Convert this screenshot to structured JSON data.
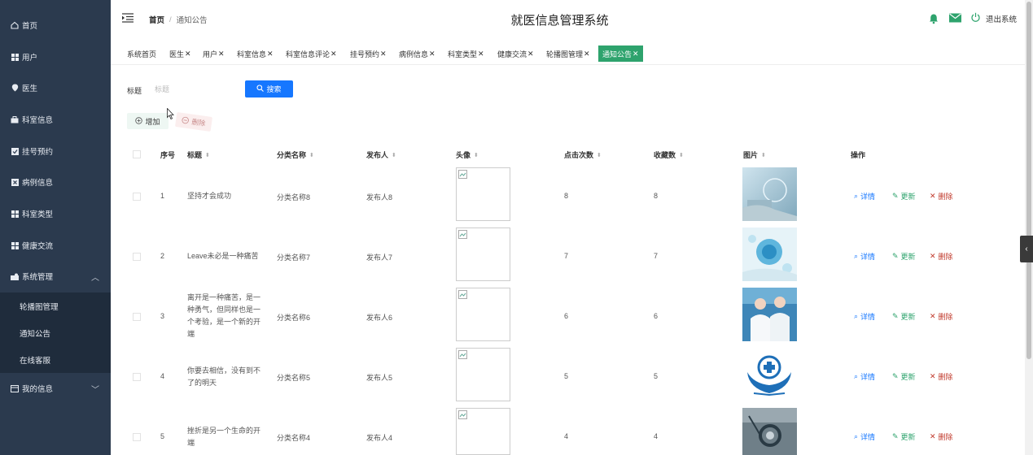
{
  "sidebar": {
    "items": [
      {
        "label": "首页",
        "icon": "home-icon"
      },
      {
        "label": "用户",
        "icon": "grid-icon"
      },
      {
        "label": "医生",
        "icon": "pin-icon"
      },
      {
        "label": "科室信息",
        "icon": "briefcase-icon"
      },
      {
        "label": "挂号预约",
        "icon": "check-square-icon"
      },
      {
        "label": "病例信息",
        "icon": "square-x-icon"
      },
      {
        "label": "科室类型",
        "icon": "grid-icon"
      },
      {
        "label": "健康交流",
        "icon": "grid-icon"
      },
      {
        "label": "系统管理",
        "icon": "settings-icon"
      },
      {
        "label": "我的信息",
        "icon": "card-icon"
      }
    ],
    "submenu": [
      "轮播图管理",
      "通知公告",
      "在线客服"
    ]
  },
  "header": {
    "breadcrumb_home": "首页",
    "breadcrumb_sep": "/",
    "breadcrumb_current": "通知公告",
    "title": "就医信息管理系统",
    "logout": "退出系统"
  },
  "tabs": [
    {
      "label": "系统首页",
      "closable": false
    },
    {
      "label": "医生",
      "closable": true
    },
    {
      "label": "用户",
      "closable": true
    },
    {
      "label": "科室信息",
      "closable": true
    },
    {
      "label": "科室信息评论",
      "closable": true
    },
    {
      "label": "挂号预约",
      "closable": true
    },
    {
      "label": "病例信息",
      "closable": true
    },
    {
      "label": "科室类型",
      "closable": true
    },
    {
      "label": "健康交流",
      "closable": true
    },
    {
      "label": "轮播图管理",
      "closable": true
    },
    {
      "label": "通知公告",
      "closable": true,
      "active": true
    }
  ],
  "search": {
    "label": "标题",
    "placeholder": "标题",
    "button": "搜索"
  },
  "actions": {
    "add": "增加",
    "delete": "删除"
  },
  "table": {
    "headers": {
      "index": "序号",
      "title": "标题",
      "category": "分类名称",
      "publisher": "发布人",
      "avatar": "头像",
      "clicks": "点击次数",
      "favorites": "收藏数",
      "picture": "图片",
      "operation": "操作"
    },
    "row_actions": {
      "detail": "详情",
      "update": "更新",
      "remove": "删除"
    },
    "rows": [
      {
        "index": "1",
        "title": "坚持才会成功",
        "category": "分类名称8",
        "publisher": "发布人8",
        "clicks": "8",
        "favorites": "8"
      },
      {
        "index": "2",
        "title": "Leave未必是一种痛苦",
        "category": "分类名称7",
        "publisher": "发布人7",
        "clicks": "7",
        "favorites": "7"
      },
      {
        "index": "3",
        "title": "离开是一种痛苦，是一种勇气，但同样也是一个考验，是一个新的开端",
        "category": "分类名称6",
        "publisher": "发布人6",
        "clicks": "6",
        "favorites": "6"
      },
      {
        "index": "4",
        "title": "你要去相信，没有到不了的明天",
        "category": "分类名称5",
        "publisher": "发布人5",
        "clicks": "5",
        "favorites": "5"
      },
      {
        "index": "5",
        "title": "挫折是另一个生命的开端",
        "category": "分类名称4",
        "publisher": "发布人4",
        "clicks": "4",
        "favorites": "4"
      }
    ]
  },
  "colors": {
    "sidebar_bg": "#2b3a4e",
    "primary": "#1677ff",
    "active_tab": "#2ea36d",
    "danger": "#c0392b"
  }
}
